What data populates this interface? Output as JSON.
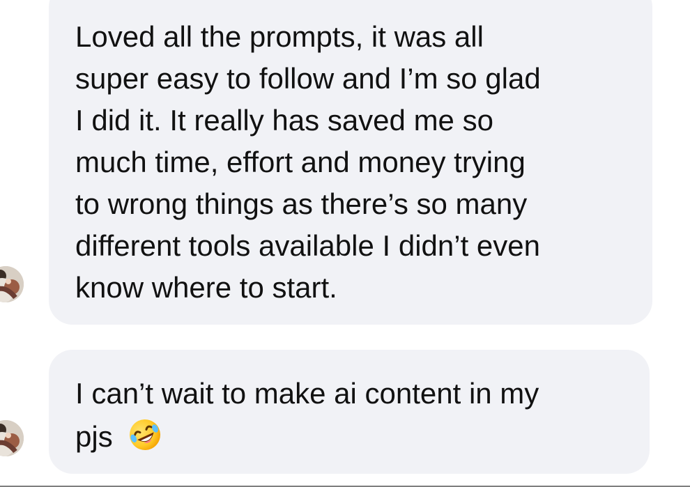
{
  "conversation": {
    "messages": [
      {
        "lines": [
          "Loved all the prompts, it was all",
          "super easy to follow and I’m so glad",
          "I did it. It really has saved me so",
          "much time, effort and money trying",
          "to wrong things as there’s so many",
          "different tools available I didn’t even",
          "know where to start."
        ]
      },
      {
        "lines": [
          "I can’t wait to make ai content in my",
          "pjs"
        ],
        "emoji": "rolling-on-floor-laughing-emoji"
      }
    ]
  },
  "avatar": {
    "icon": "profile-avatar"
  },
  "colors": {
    "bubble_background": "#f1f2f6",
    "message_text": "#111111",
    "page_background": "#ffffff",
    "divider": "#7f7f7f"
  }
}
